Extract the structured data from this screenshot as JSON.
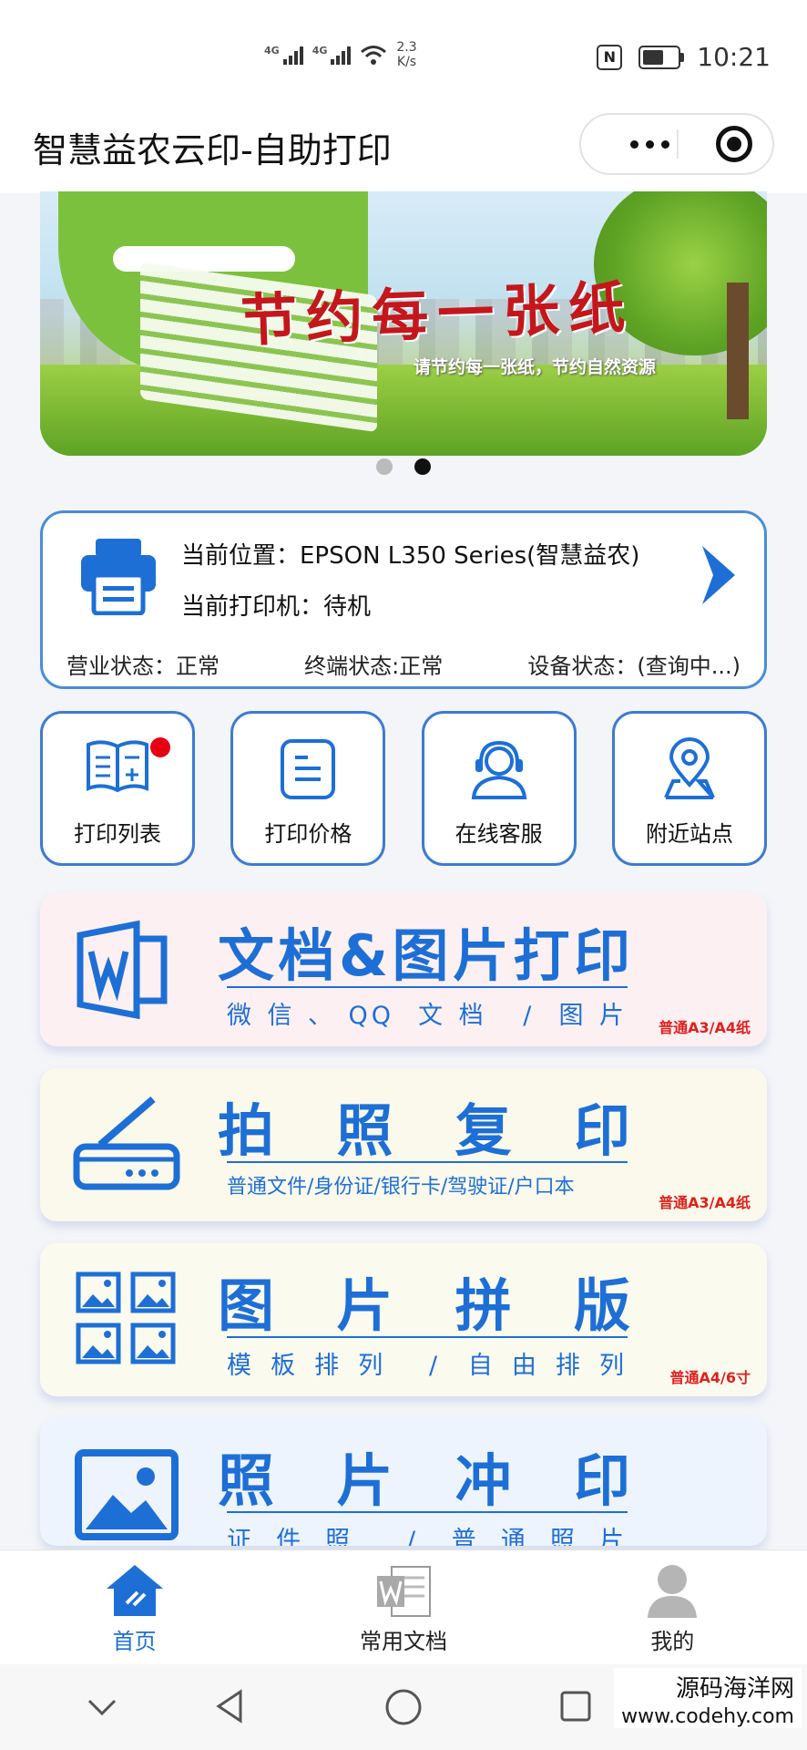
{
  "status_bar": {
    "signal1": "4G",
    "signal2": "4G",
    "speed_value": "2.3",
    "speed_unit": "K/s",
    "nfc": "N",
    "battery_level": 0.6,
    "time": "10:21"
  },
  "title_bar": {
    "title": "智慧益农云印-自助打印",
    "more_icon": "more-dots-icon",
    "close_icon": "target-close-icon"
  },
  "banner": {
    "slogan": "节约每一张纸",
    "subtitle": "请节约每一张纸，节约自然资源",
    "slides": 2,
    "active_slide": 2
  },
  "printer": {
    "location": "当前位置：EPSON L350 Series(智慧益农)",
    "status": "当前打印机：待机",
    "business_status": "营业状态：正常",
    "terminal_status": "终端状态:正常",
    "device_status": "设备状态：(查询中...)"
  },
  "quick_actions": [
    {
      "label": "打印列表",
      "icon": "book-list-icon",
      "badge": true
    },
    {
      "label": "打印价格",
      "icon": "price-doc-icon",
      "badge": false
    },
    {
      "label": "在线客服",
      "icon": "customer-service-icon",
      "badge": false
    },
    {
      "label": "附近站点",
      "icon": "location-pin-icon",
      "badge": false
    }
  ],
  "features": [
    {
      "title": "文档&图片打印",
      "subtitle": "微信、QQ 文档 / 图片",
      "tag": "普通A3/A4纸",
      "icon": "word-doc-icon"
    },
    {
      "title": "拍照复印",
      "subtitle": "普通文件/身份证/银行卡/驾驶证/户口本",
      "tag": "普通A3/A4纸",
      "icon": "scanner-icon"
    },
    {
      "title": "图片拼版",
      "subtitle": "模板排列 / 自由排列",
      "tag": "普通A4/6寸",
      "icon": "image-grid-icon"
    },
    {
      "title": "照片冲印",
      "subtitle": "证件照 / 普通照片",
      "tag": "",
      "icon": "photo-icon"
    }
  ],
  "tabs": [
    {
      "label": "首页",
      "icon": "home-icon",
      "active": true
    },
    {
      "label": "常用文档",
      "icon": "word-file-icon",
      "active": false
    },
    {
      "label": "我的",
      "icon": "user-icon",
      "active": false
    }
  ],
  "watermark": {
    "name": "源码海洋网",
    "url": "www.codehy.com"
  },
  "colors": {
    "accent": "#1d6fd6",
    "card_border": "#4a8cd8",
    "badge": "#e60012",
    "tag": "#e0201c"
  }
}
